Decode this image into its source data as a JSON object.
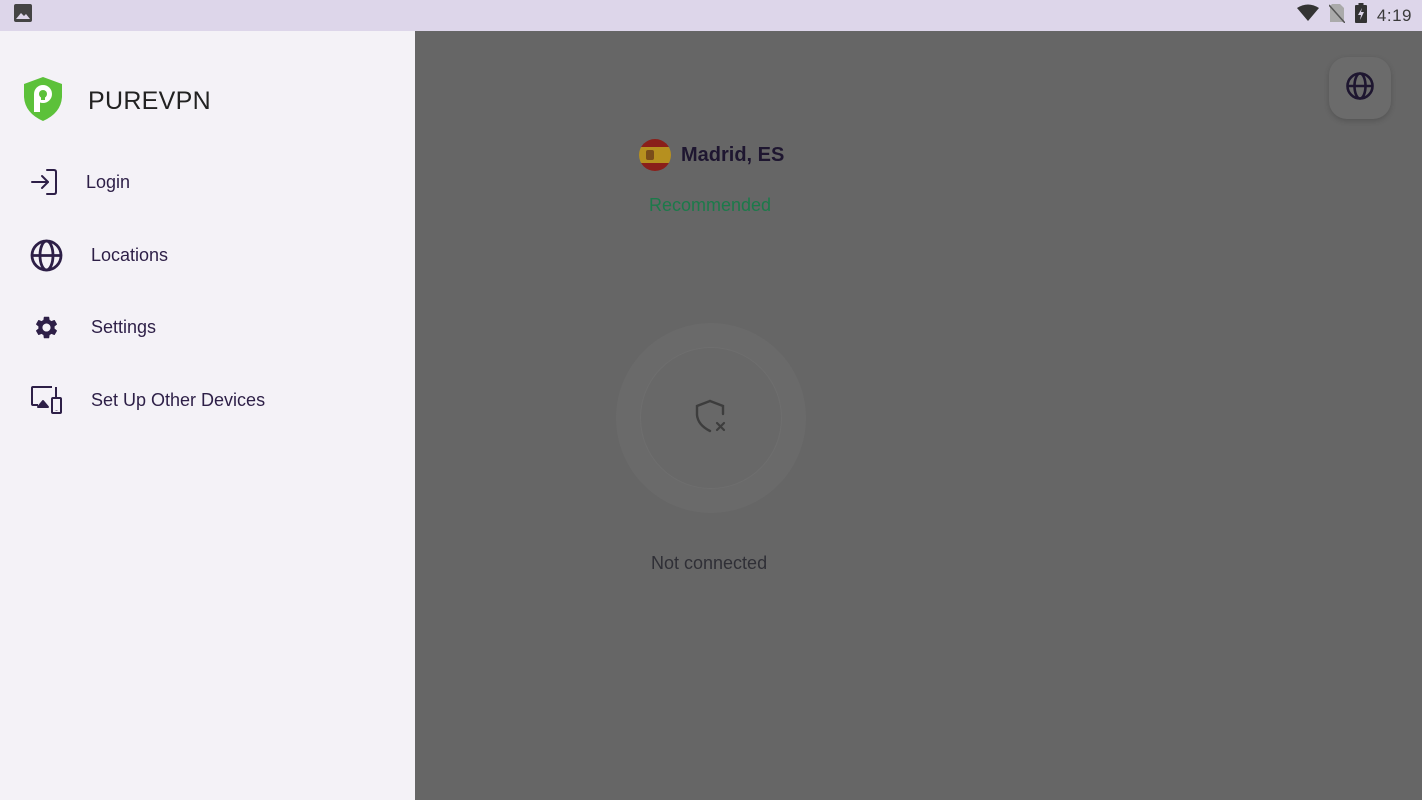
{
  "status_bar": {
    "left_icons": [
      "image-icon"
    ],
    "right_icons": [
      "wifi-icon",
      "no-sim-icon",
      "battery-charging-icon"
    ],
    "time": "4:19"
  },
  "drawer": {
    "brand": {
      "name": "PUREVPN",
      "logo": "purevpn-shield-logo",
      "logo_color": "#5cc13a"
    },
    "menu": [
      {
        "label": "Login",
        "icon": "login-icon"
      },
      {
        "label": "Locations",
        "icon": "globe-icon"
      },
      {
        "label": "Settings",
        "icon": "gear-icon"
      },
      {
        "label": "Set Up Other Devices",
        "icon": "devices-icon"
      }
    ]
  },
  "main": {
    "location": {
      "name": "Madrid, ES",
      "flag": "spain-flag",
      "tag": "Recommended"
    },
    "connect_button_icon": "shield-x-icon",
    "connection_status": "Not connected",
    "globe_button_icon": "globe-icon",
    "accent_color": "#1c7a4a"
  }
}
